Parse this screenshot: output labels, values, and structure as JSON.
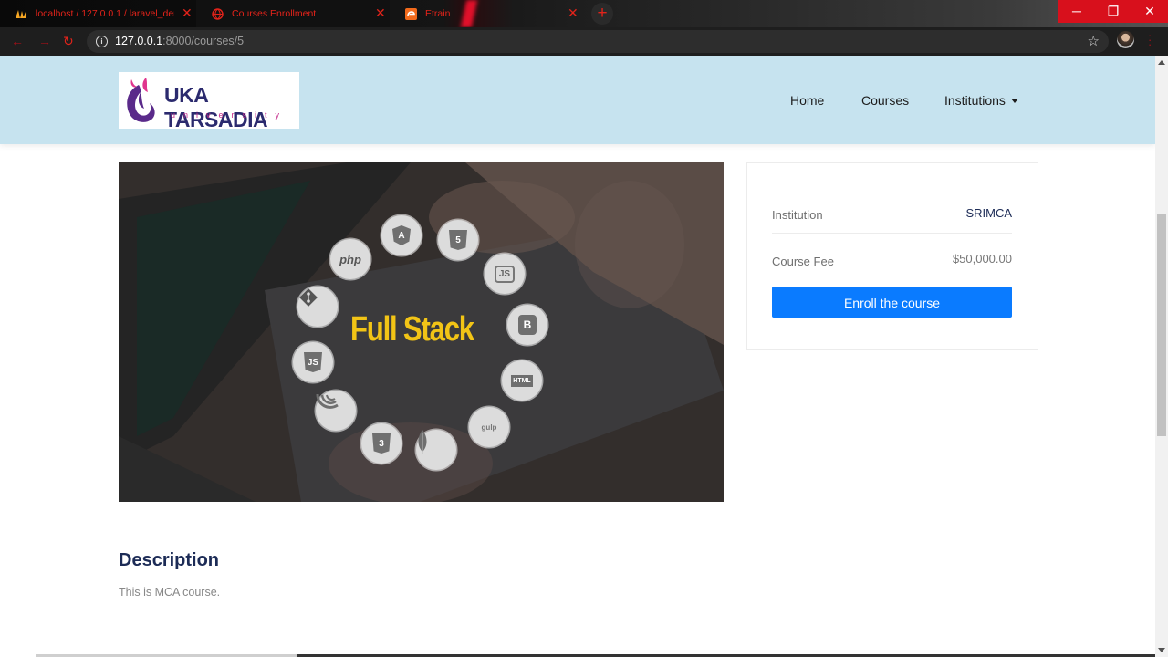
{
  "browser": {
    "tabs": [
      {
        "title": "localhost / 127.0.0.1 / laravel_demo",
        "icon": "phpmyadmin-icon"
      },
      {
        "title": "Courses Enrollment",
        "icon": "globe-icon"
      },
      {
        "title": "Etrain",
        "icon": "etrain-icon"
      }
    ],
    "url_host": "127.0.0.1",
    "url_path": ":8000/courses/5",
    "accent_color": "#e2231a",
    "window_controls": {
      "minimize": "─",
      "restore": "❐",
      "close": "✕"
    }
  },
  "site": {
    "logo": {
      "name": "UKA TARSADIA",
      "subtitle": "university"
    },
    "nav": {
      "home": "Home",
      "courses": "Courses",
      "institutions": "Institutions"
    }
  },
  "course": {
    "image_headline": "Full Stack",
    "tech_icons": [
      "php",
      "A",
      "5",
      "JS",
      "B",
      "HTML",
      "gulp",
      "leaf",
      "3",
      "jQuery",
      "JS",
      "git"
    ],
    "institution_label": "Institution",
    "institution_value": "SRIMCA",
    "fee_label": "Course Fee",
    "fee_value": "$50,000.00",
    "enroll_button": "Enroll the course",
    "description_heading": "Description",
    "description_text": "This is MCA course."
  },
  "colors": {
    "header_bg": "#c6e3ef",
    "button": "#0a7bff",
    "heading": "#1c2b56"
  }
}
